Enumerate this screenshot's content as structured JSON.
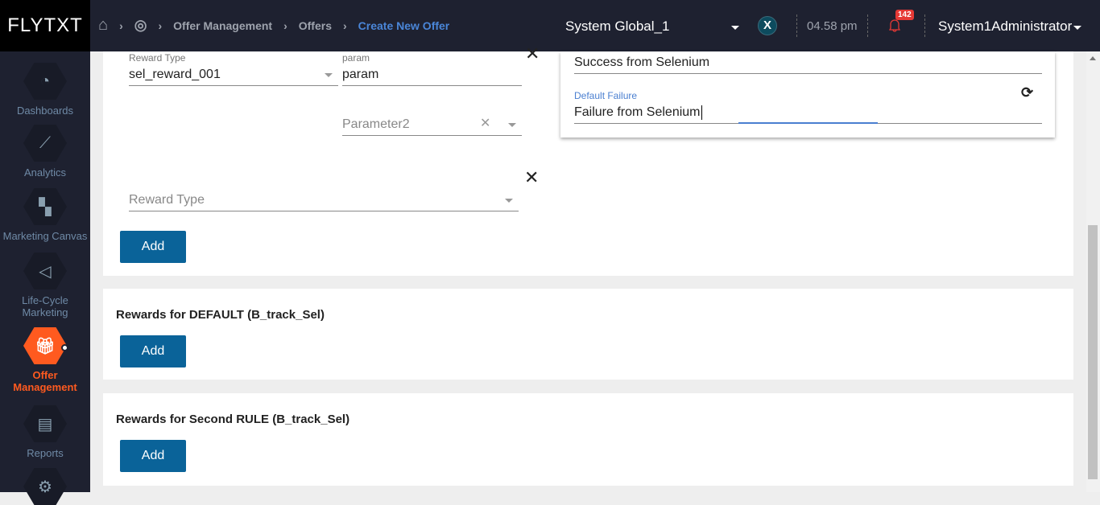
{
  "header": {
    "logo": "FLYTXT",
    "breadcrumb": [
      "Offer Management",
      "Offers",
      "Create New Offer"
    ],
    "system": "System Global_1",
    "time": "04.58 pm",
    "notifications": "142",
    "user": "System1Administrator",
    "accent": "#4a86d8"
  },
  "sidebar": {
    "items": [
      {
        "label": "Dashboards",
        "icon": "gauge-icon"
      },
      {
        "label": "Analytics",
        "icon": "line-chart-icon"
      },
      {
        "label": "Marketing Canvas",
        "icon": "flow-icon"
      },
      {
        "label": "Life-Cycle Marketing",
        "icon": "megaphone-icon"
      },
      {
        "label": "Offer Management",
        "icon": "gift-icon",
        "active": true
      },
      {
        "label": "Reports",
        "icon": "report-icon"
      },
      {
        "label": "",
        "icon": "gear-icon"
      }
    ],
    "active_color": "#ff5a1f"
  },
  "rewards": {
    "reward_type_label": "Reward Type",
    "reward_type_value": "sel_reward_001",
    "param_label": "param",
    "param_value": "param",
    "parameter2_placeholder": "Parameter2",
    "reward_type_placeholder": "Reward Type",
    "add": "Add"
  },
  "popup": {
    "success_value": "Success from Selenium",
    "failure_label": "Default Failure",
    "failure_value": "Failure from Selenium"
  },
  "sections": [
    {
      "title": "Rewards for DEFAULT (B_track_Sel)",
      "add": "Add"
    },
    {
      "title": "Rewards for Second RULE (B_track_Sel)",
      "add": "Add"
    }
  ]
}
